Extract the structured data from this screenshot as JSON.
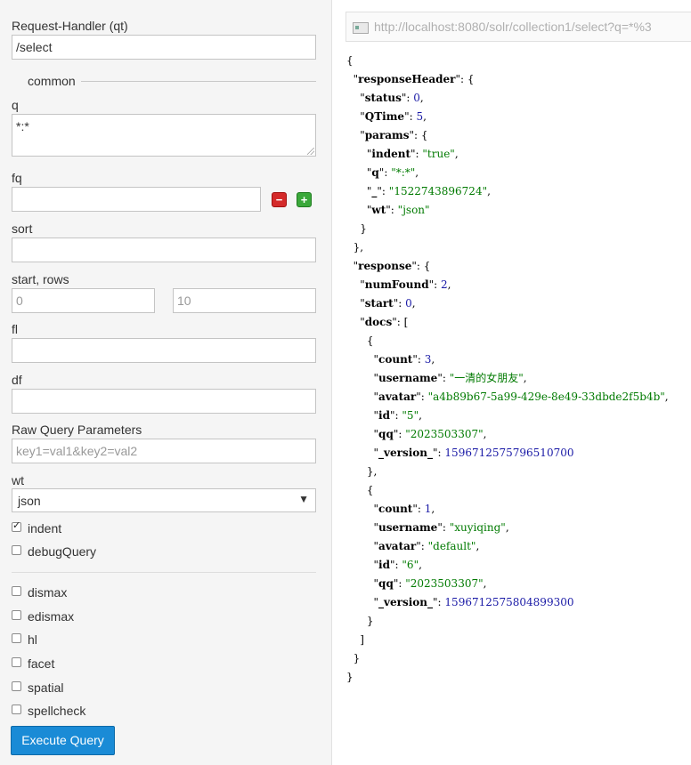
{
  "form": {
    "request_handler_label": "Request-Handler (qt)",
    "request_handler_value": "/select",
    "section_common": "common",
    "q_label": "q",
    "q_value": "*:*",
    "fq_label": "fq",
    "sort_label": "sort",
    "start_rows_label": "start, rows",
    "start_placeholder": "0",
    "rows_placeholder": "10",
    "fl_label": "fl",
    "df_label": "df",
    "raw_label": "Raw Query Parameters",
    "raw_placeholder": "key1=val1&key2=val2",
    "wt_label": "wt",
    "wt_value": "json",
    "indent_label": "indent",
    "indent_checked": true,
    "debug_label": "debugQuery",
    "options": [
      "dismax",
      "edismax",
      "hl",
      "facet",
      "spatial",
      "spellcheck"
    ],
    "execute_label": "Execute Query"
  },
  "icons": {
    "remove": "minus-icon",
    "add": "plus-icon",
    "url": "page-icon"
  },
  "colors": {
    "execute": "#1a8bd6",
    "json_string": "#007a00",
    "json_number": "#1a1aa6"
  },
  "result": {
    "url": "http://localhost:8080/solr/collection1/select?q=*%3",
    "responseHeader": {
      "status": 0,
      "QTime": 5,
      "params": {
        "indent": "true",
        "q": "*:*",
        "_": "1522743896724",
        "wt": "json"
      }
    },
    "response": {
      "numFound": 2,
      "start": 0,
      "docs": [
        {
          "count": 3,
          "username": "一清的女朋友",
          "avatar": "a4b89b67-5a99-429e-8e49-33dbde2f5b4b",
          "id": "5",
          "qq": "2023503307",
          "_version_": "1596712575796510700"
        },
        {
          "count": 1,
          "username": "xuyiqing",
          "avatar": "default",
          "id": "6",
          "qq": "2023503307",
          "_version_": "1596712575804899300"
        }
      ]
    }
  }
}
